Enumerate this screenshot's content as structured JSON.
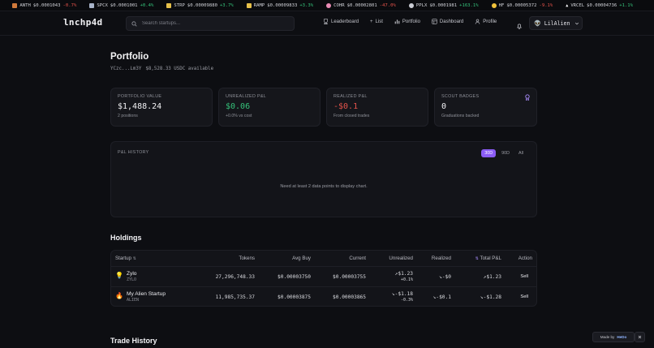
{
  "ticker": [
    {
      "symbol": "ANTH",
      "price": "$0.0001043",
      "change": "-0.7%",
      "dir": "down",
      "icon": "anth-icon",
      "color": "#d07a3b"
    },
    {
      "symbol": "SPCX",
      "price": "$0.0001001",
      "change": "+0.4%",
      "dir": "up",
      "icon": "rocket-icon",
      "color": "#a8b4c9"
    },
    {
      "symbol": "STRP",
      "price": "$0.00009880",
      "change": "+3.7%",
      "dir": "up",
      "icon": "card-icon",
      "color": "#e6c04a"
    },
    {
      "symbol": "RAMP",
      "price": "$0.00009833",
      "change": "+3.3%",
      "dir": "up",
      "icon": "ramp-icon",
      "color": "#e6c04a"
    },
    {
      "symbol": "COHR",
      "price": "$0.00002801",
      "change": "-47.0%",
      "dir": "down",
      "icon": "brain-icon",
      "color": "#e98bb4"
    },
    {
      "symbol": "PPLX",
      "price": "$0.0001981",
      "change": "+163.1%",
      "dir": "up",
      "icon": "magnifier-icon",
      "color": "#c9cbd3"
    },
    {
      "symbol": "HF",
      "price": "$0.00005372",
      "change": "-9.1%",
      "dir": "down",
      "icon": "hugging-face-icon",
      "color": "#f0c23b"
    },
    {
      "symbol": "VRCEL",
      "price": "$0.00004736",
      "change": "+1.1%",
      "dir": "up",
      "icon": "triangle-icon",
      "color": "#ffffff"
    }
  ],
  "nav": {
    "logo": "lnchp4d",
    "search_placeholder": "Search startups...",
    "links": [
      "Leaderboard",
      "List",
      "Portfolio",
      "Dashboard",
      "Profile"
    ],
    "username": "LilAlien"
  },
  "portfolio": {
    "title": "Portfolio",
    "wallet": "YCzc...Lm3Y",
    "balance": "$8,528.33 USDC available"
  },
  "cards": {
    "portfolio_value": {
      "label": "PORTFOLIO VALUE",
      "value": "$1,488.24",
      "note": "2 positions"
    },
    "unrealized": {
      "label": "UNREALIZED P&L",
      "value": "$0.06",
      "note": "+0.0% vs cost"
    },
    "realized": {
      "label": "REALIZED P&L",
      "value": "-$0.1",
      "note": "From closed trades"
    },
    "scout": {
      "label": "SCOUT BADGES",
      "value": "0",
      "note": "Graduations backed"
    }
  },
  "pnl_history": {
    "label": "P&L HISTORY",
    "ranges": [
      "30D",
      "90D",
      "All"
    ],
    "active_range": "30D",
    "empty_message": "Need at least 2 data points to display chart."
  },
  "holdings": {
    "title": "Holdings",
    "columns": {
      "startup": "Startup",
      "tokens": "Tokens",
      "avg_buy": "Avg Buy",
      "current": "Current",
      "unrealized": "Unrealized",
      "realized": "Realized",
      "total": "Total P&L",
      "action": "Action"
    },
    "rows": [
      {
        "name": "Zylo",
        "symbol": "ZYLO",
        "tokens": "27,296,748.33",
        "avg_buy": "$0.00003750",
        "current": "$0.00003755",
        "unrealized": "$1.23",
        "unrealized_pct": "+0.1%",
        "realized": "-$0",
        "total": "$1.23",
        "action": "Sell",
        "dir": "up"
      },
      {
        "name": "My Alien Startup",
        "symbol": "ALIEN",
        "tokens": "11,985,735.37",
        "avg_buy": "$0.00003875",
        "current": "$0.00003865",
        "unrealized": "-$1.18",
        "unrealized_pct": "-0.3%",
        "realized": "-$0.1",
        "total": "-$1.28",
        "action": "Sell",
        "dir": "down"
      }
    ]
  },
  "trade_history": {
    "title": "Trade History"
  },
  "footer": {
    "made_by": "Made by",
    "brand": "HeDo"
  }
}
